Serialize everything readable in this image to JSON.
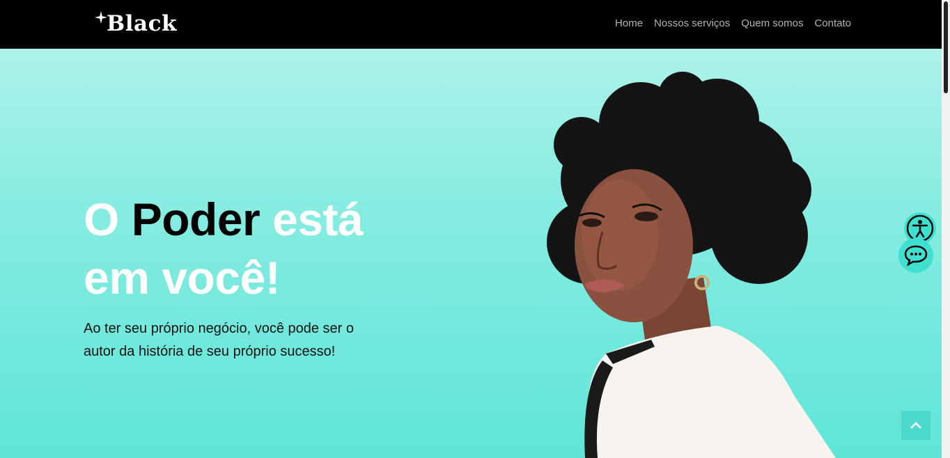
{
  "brand": {
    "name": "Black",
    "icon": "sparkle-star-icon"
  },
  "nav": {
    "items": [
      {
        "label": "Home"
      },
      {
        "label": "Nossos serviços"
      },
      {
        "label": "Quem somos"
      },
      {
        "label": "Contato"
      }
    ]
  },
  "hero": {
    "headline": {
      "part1": "O",
      "part2": "Poder",
      "part3": "está",
      "part4": "em você!"
    },
    "subtext": "Ao ter seu próprio negócio, você pode ser o autor da história de seu próprio sucesso!"
  },
  "widgets": {
    "accessibility_icon": "accessibility-icon",
    "chat_icon": "chat-bubble-icon",
    "back_to_top_icon": "chevron-up-icon"
  },
  "colors": {
    "navbar_bg": "#000000",
    "nav_link": "#b3b3b3",
    "hero_top": "#acf2ea",
    "hero_bottom": "#5fe5d8",
    "accent": "#40e0d0"
  }
}
